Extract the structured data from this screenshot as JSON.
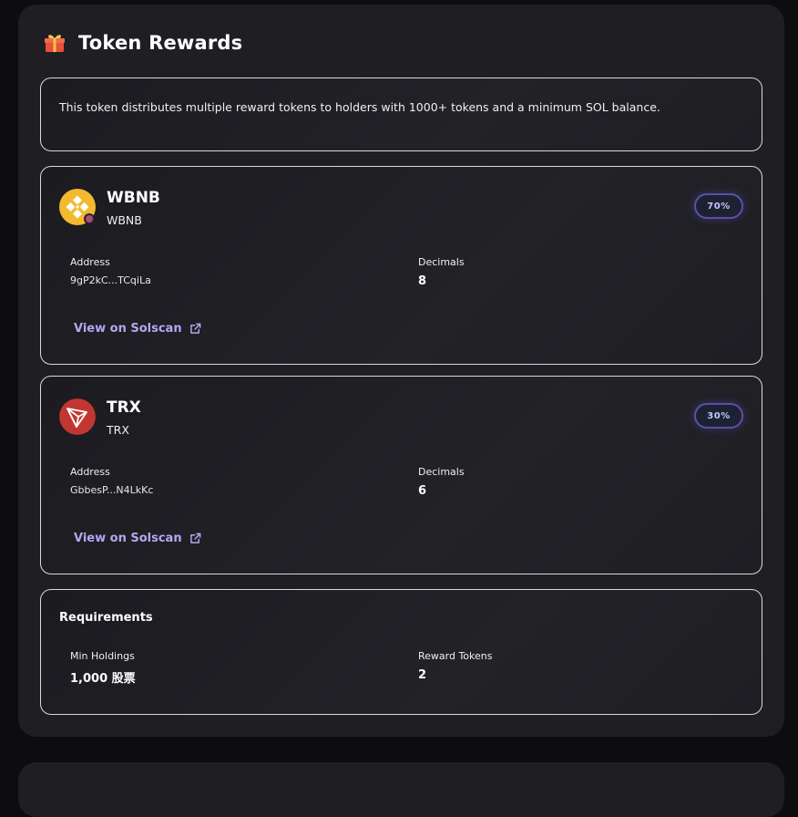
{
  "header": {
    "title": "Token Rewards",
    "icon": "gift-icon"
  },
  "description": "This token distributes multiple reward tokens to holders with 1000+ tokens and a minimum SOL balance.",
  "tokens": [
    {
      "name": "WBNB",
      "symbol": "WBNB",
      "share": "70%",
      "address_label": "Address",
      "address": "9gP2kC...TCqiLa",
      "decimals_label": "Decimals",
      "decimals": "8",
      "link_label": "View on Solscan",
      "icon": "bnb-logo-icon",
      "icon_color": "#F3BA2F"
    },
    {
      "name": "TRX",
      "symbol": "TRX",
      "share": "30%",
      "address_label": "Address",
      "address": "GbbesP...N4LkKc",
      "decimals_label": "Decimals",
      "decimals": "6",
      "link_label": "View on Solscan",
      "icon": "tron-logo-icon",
      "icon_color": "#C23631"
    }
  ],
  "requirements": {
    "title": "Requirements",
    "min_holdings_label": "Min Holdings",
    "min_holdings": "1,000 股票",
    "reward_tokens_label": "Reward Tokens",
    "reward_tokens": "2"
  },
  "colors": {
    "background": "#0d0d0f",
    "panel": "#1f1f23",
    "accent": "#b4a7f2",
    "badge_border": "#5b4fa8"
  }
}
